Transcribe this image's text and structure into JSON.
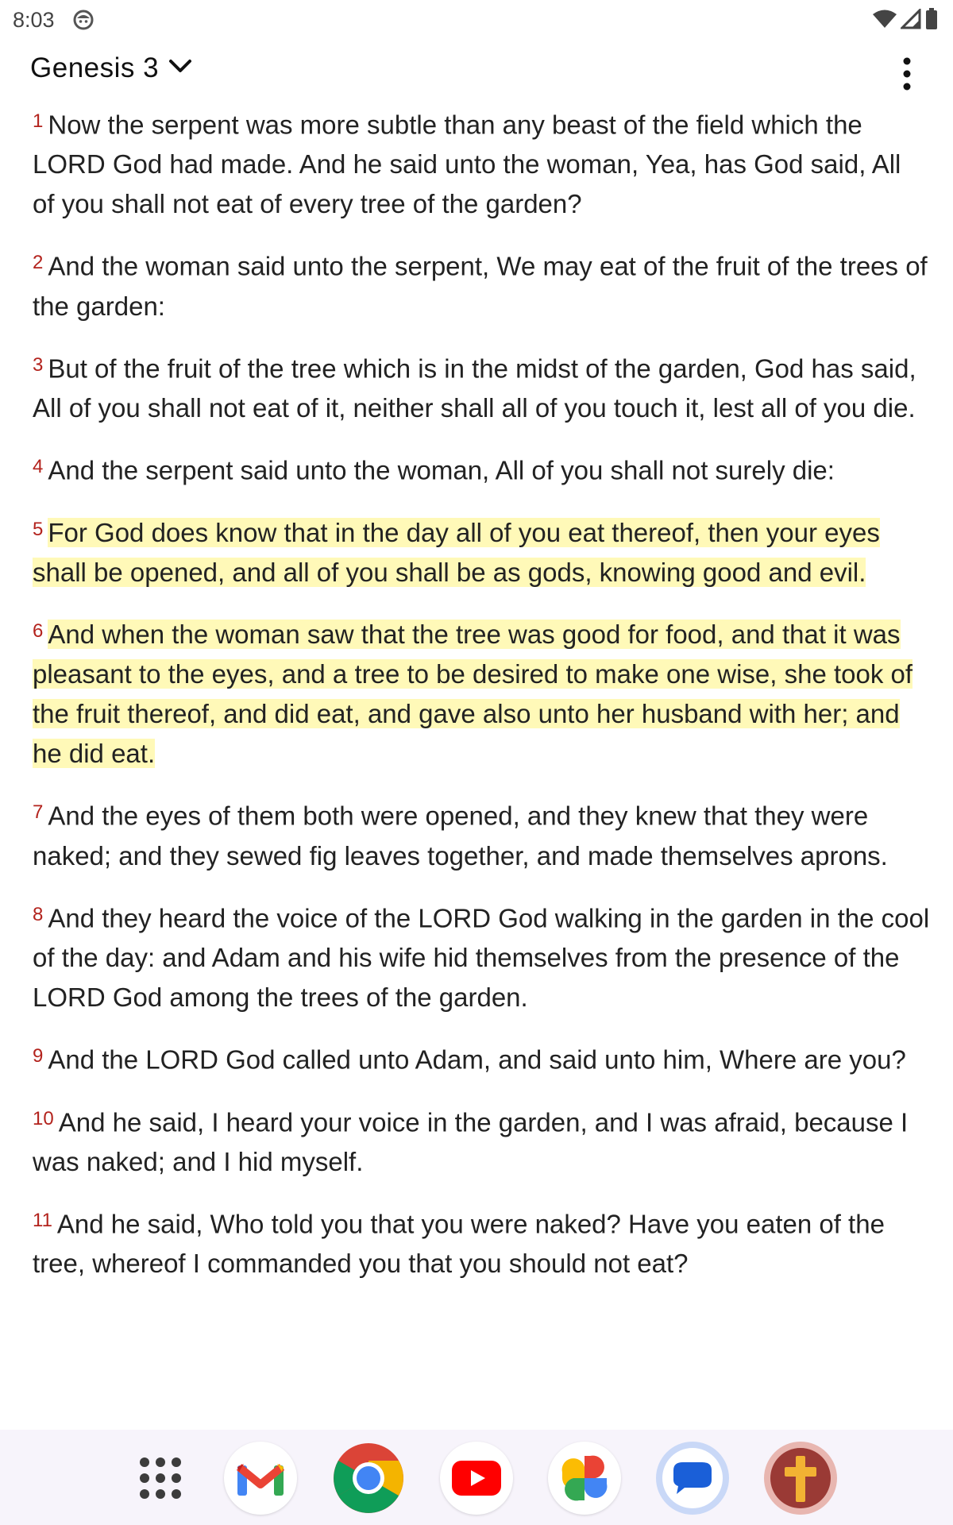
{
  "status_bar": {
    "time": "8:03"
  },
  "app_bar": {
    "book_title": "Genesis 3"
  },
  "verses": [
    {
      "num": "1",
      "text": "Now the serpent was more subtle than any beast of the field which the LORD God had made. And he said unto the woman, Yea, has God said, All of you shall not eat of every tree of the garden?",
      "highlighted": false
    },
    {
      "num": "2",
      "text": "And the woman said unto the serpent, We may eat of the fruit of the trees of the garden:",
      "highlighted": false
    },
    {
      "num": "3",
      "text": "But of the fruit of the tree which is in the midst of the garden, God has said, All of you shall not eat of it, neither shall all of you touch it, lest all of you die.",
      "highlighted": false
    },
    {
      "num": "4",
      "text": "And the serpent said unto the woman, All of you shall not surely die:",
      "highlighted": false
    },
    {
      "num": "5",
      "text": "For God does know that in the day all of you eat thereof, then your eyes shall be opened, and all of you shall be as gods, knowing good and evil.",
      "highlighted": true
    },
    {
      "num": "6",
      "text": "And when the woman saw that the tree was good for food, and that it was pleasant to the eyes, and a tree to be desired to make one wise, she took of the fruit thereof, and did eat, and gave also unto her husband with her; and he did eat.",
      "highlighted": true
    },
    {
      "num": "7",
      "text": "And the eyes of them both were opened, and they knew that they were naked; and they sewed fig leaves together, and made themselves aprons.",
      "highlighted": false
    },
    {
      "num": "8",
      "text": "And they heard the voice of the LORD God walking in the garden in the cool of the day: and Adam and his wife hid themselves from the presence of the LORD God among the trees of the garden.",
      "highlighted": false
    },
    {
      "num": "9",
      "text": "And the LORD God called unto Adam, and said unto him, Where are you?",
      "highlighted": false
    },
    {
      "num": "10",
      "text": "And he said, I heard your voice in the garden, and I was afraid, because I was naked; and I hid myself.",
      "highlighted": false
    },
    {
      "num": "11",
      "text": "And he said, Who told you that you were naked? Have you eaten of the tree, whereof I commanded you that you should not eat?",
      "highlighted": false
    }
  ],
  "dock": {
    "apps": [
      {
        "name": "app-drawer",
        "icon": "grid-dots-icon"
      },
      {
        "name": "gmail",
        "icon": "gmail-icon"
      },
      {
        "name": "chrome",
        "icon": "chrome-icon"
      },
      {
        "name": "youtube",
        "icon": "youtube-icon"
      },
      {
        "name": "photos",
        "icon": "photos-icon"
      },
      {
        "name": "messages",
        "icon": "messages-icon"
      },
      {
        "name": "bible",
        "icon": "cross-icon"
      }
    ]
  },
  "colors": {
    "verse_number": "#b3231d",
    "highlight": "#fff9b8",
    "dock_background": "#f7f4fb"
  }
}
